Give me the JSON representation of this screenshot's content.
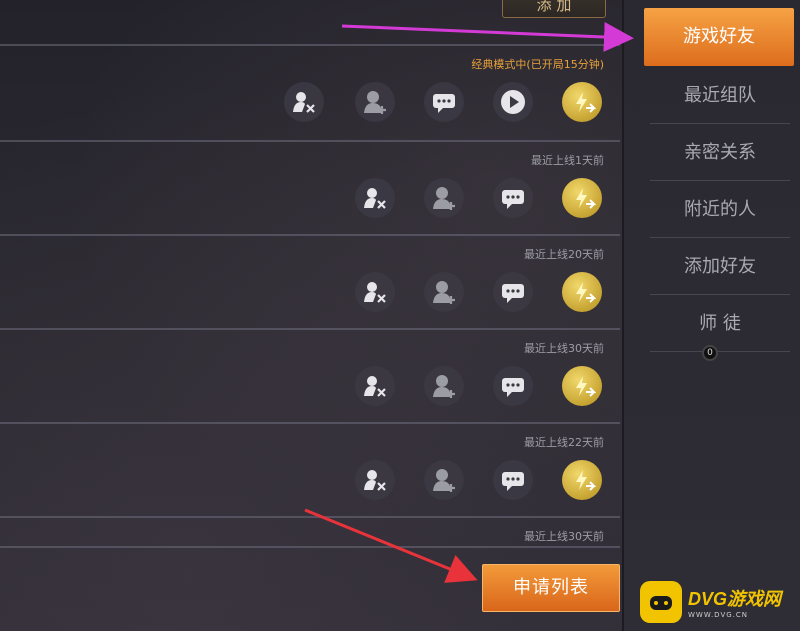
{
  "top_button": {
    "label": "添 加"
  },
  "friend_rows": [
    {
      "status": "经典模式中(已开局15分钟)",
      "status_state": "active",
      "actions": [
        "remove-friend",
        "add-friend",
        "chat",
        "spectate",
        "energy-gift"
      ]
    },
    {
      "status": "最近上线1天前",
      "status_state": "offline",
      "actions": [
        "remove-friend",
        "add-friend",
        "chat",
        "energy-gift"
      ]
    },
    {
      "status": "最近上线20天前",
      "status_state": "offline",
      "actions": [
        "remove-friend",
        "add-friend",
        "chat",
        "energy-gift"
      ]
    },
    {
      "status": "最近上线30天前",
      "status_state": "offline",
      "actions": [
        "remove-friend",
        "add-friend",
        "chat",
        "energy-gift"
      ]
    },
    {
      "status": "最近上线22天前",
      "status_state": "offline",
      "actions": [
        "remove-friend",
        "add-friend",
        "chat",
        "energy-gift"
      ]
    },
    {
      "status": "最近上线30天前",
      "status_state": "offline",
      "actions": []
    }
  ],
  "apply_button": {
    "label": "申请列表"
  },
  "sidebar": {
    "items": [
      {
        "label": "游戏好友",
        "active": true
      },
      {
        "label": "最近组队",
        "active": false
      },
      {
        "label": "亲密关系",
        "active": false
      },
      {
        "label": "附近的人",
        "active": false
      },
      {
        "label": "添加好友",
        "active": false
      },
      {
        "label": "师 徒",
        "active": false
      }
    ],
    "badge": "0"
  },
  "watermark": {
    "brand": "DVG游戏网",
    "url": "WWW.DVG.CN"
  },
  "colors": {
    "accent_orange": "#e8821e",
    "status_active": "#e8a23a",
    "arrow_magenta": "#d43ad6",
    "arrow_red": "#e8333a"
  },
  "icons": {
    "remove-friend": "person-x-icon",
    "add-friend": "person-plus-icon",
    "chat": "chat-bubble-icon",
    "spectate": "play-icon",
    "energy-gift": "lightning-coin-icon"
  }
}
